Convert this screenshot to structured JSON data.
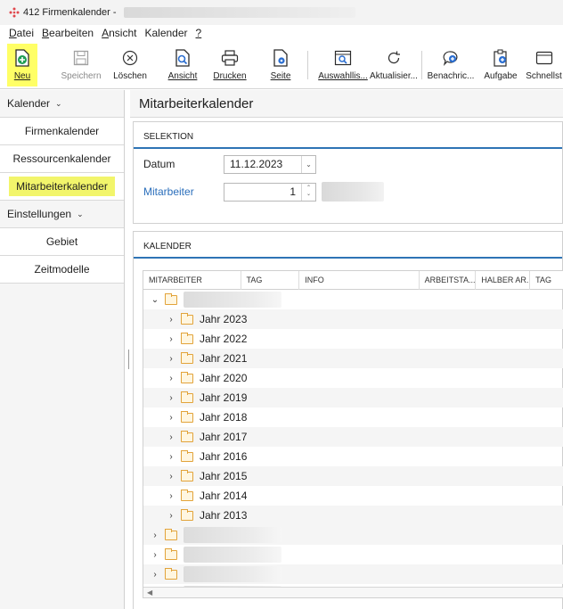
{
  "window": {
    "title": "412 Firmenkalender -"
  },
  "menu": [
    {
      "pre": "",
      "key": "D",
      "post": "atei"
    },
    {
      "pre": "",
      "key": "B",
      "post": "earbeiten"
    },
    {
      "pre": "",
      "key": "A",
      "post": "nsicht"
    },
    {
      "pre": "",
      "key": "",
      "post": "Kalender"
    },
    {
      "pre": "",
      "key": "?",
      "post": ""
    }
  ],
  "toolbar": {
    "neu": "Neu",
    "speichern": "Speichern",
    "loeschen": "Löschen",
    "ansicht": "Ansicht",
    "drucken": "Drucken",
    "seite": "Seite",
    "auswahlliste": "Auswahllis...",
    "aktualisieren": "Aktualisier...",
    "benachrichtigung": "Benachric...",
    "aufgabe": "Aufgabe",
    "schnellstart": "Schnellst"
  },
  "sidebar": {
    "groups": [
      {
        "label": "Kalender",
        "items": [
          "Firmenkalender",
          "Ressourcenkalender",
          "Mitarbeiterkalender"
        ]
      },
      {
        "label": "Einstellungen",
        "items": [
          "Gebiet",
          "Zeitmodelle"
        ]
      }
    ],
    "active_item": "Mitarbeiterkalender"
  },
  "main": {
    "title": "Mitarbeiterkalender",
    "selection": {
      "heading": "SELEKTION",
      "datum_label": "Datum",
      "datum_value": "11.12.2023",
      "mitarbeiter_label": "Mitarbeiter",
      "mitarbeiter_value": "1"
    },
    "calendar": {
      "heading": "KALENDER",
      "columns": [
        "MITARBEITER",
        "TAG",
        "INFO",
        "ARBEITSTA...",
        "HALBER AR...",
        "TAG"
      ],
      "years": [
        "Jahr 2023",
        "Jahr 2022",
        "Jahr 2021",
        "Jahr 2020",
        "Jahr 2019",
        "Jahr 2018",
        "Jahr 2017",
        "Jahr 2016",
        "Jahr 2015",
        "Jahr 2014",
        "Jahr 2013"
      ]
    }
  },
  "colors": {
    "accent_blue": "#2e74b5",
    "highlight_yellow": "#ffff66",
    "folder_orange": "#e2a33a",
    "link_blue": "#2a6ebb"
  }
}
